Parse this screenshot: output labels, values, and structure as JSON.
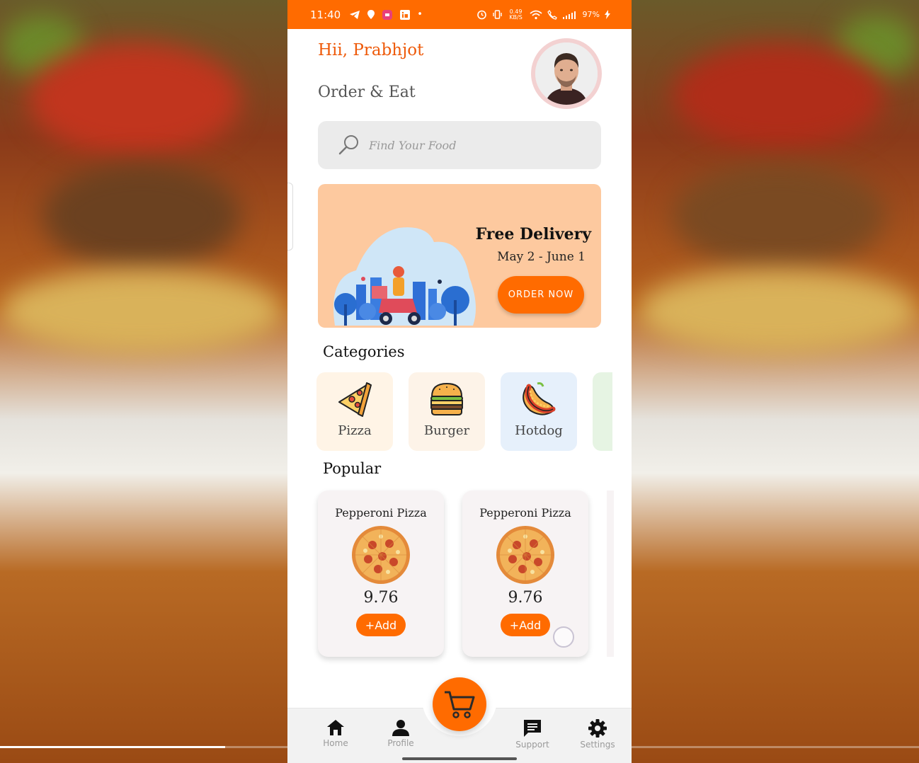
{
  "status_bar": {
    "time": "11:40",
    "net_speed": "0.49 KB/S",
    "battery": "97%"
  },
  "header": {
    "greeting": "Hii, Prabhjot",
    "subtitle": "Order & Eat"
  },
  "search": {
    "placeholder": "Find Your Food",
    "value": ""
  },
  "banner": {
    "title": "Free Delivery",
    "dates": "May 2 - June 1",
    "button_label": "ORDER NOW"
  },
  "categories": {
    "title": "Categories",
    "items": [
      {
        "label": "Pizza",
        "icon": "pizza-icon",
        "bg": "#fff4e6"
      },
      {
        "label": "Burger",
        "icon": "burger-icon",
        "bg": "#fdf3e8"
      },
      {
        "label": "Hotdog",
        "icon": "hotdog-icon",
        "bg": "#e6f0fb"
      }
    ]
  },
  "popular": {
    "title": "Popular",
    "items": [
      {
        "name": "Pepperoni Pizza",
        "price": "9.76",
        "add_label": "+Add"
      },
      {
        "name": "Pepperoni Pizza",
        "price": "9.76",
        "add_label": "+Add"
      }
    ]
  },
  "bottom_nav": {
    "items": [
      {
        "label": "Home",
        "icon": "home-icon"
      },
      {
        "label": "Profile",
        "icon": "person-icon"
      },
      {
        "label": "Support",
        "icon": "chat-icon"
      },
      {
        "label": "Settings",
        "icon": "gear-icon"
      }
    ],
    "fab_icon": "cart-icon"
  },
  "video_progress": 0.245,
  "colors": {
    "accent": "#ff6b00",
    "banner_bg": "#fdc99f",
    "greeting": "#ee5a0a"
  }
}
